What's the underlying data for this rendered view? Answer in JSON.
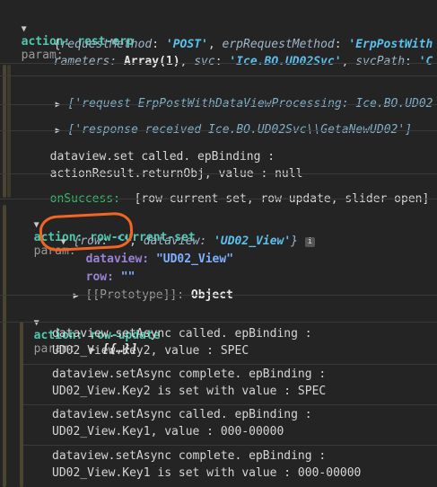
{
  "header": {
    "action_label": "action: rest-erp",
    "param_label": "param:",
    "obj_line1_prefix": "{",
    "k_requestMethod": "requestMethod",
    "v_requestMethod": "'POST'",
    "k_erpRequestMethod": "erpRequestMethod",
    "v_erpRequestMethod": "'ErpPostWith",
    "line2_pre": "rameters: ",
    "line2_arr": "Array(1)",
    "k_svc": "svc",
    "v_svc": "'Ice.BO.UD02Svc'",
    "k_svcPath": "svcPath",
    "v_svcPath": "'C"
  },
  "groups": {
    "request_line": "['request ErpPostWithDataViewProcessing: Ice.BO.UD02",
    "response_line": "['response received Ice.BO.UD02Svc\\\\GetaNewUD02']",
    "dataview_set_1": "dataview.set called. epBinding :",
    "dataview_set_2": "actionResult.returnObj, value : null",
    "onsuccess_label": "onSuccess:",
    "onsuccess_value": "[row-current-set, row-update, slider-open]"
  },
  "row_current_set": {
    "action_label": "action: row-current-set",
    "param_label": "param:",
    "preview_prefix": "{",
    "row_key": "row:",
    "row_val": "''",
    "dv_key": "dataview:",
    "dv_val": "'UD02_View'",
    "preview_suffix": "}",
    "info": "i",
    "prop_dataview_key": "dataview:",
    "prop_dataview_val": "\"UD02_View\"",
    "prop_row_key": "row:",
    "prop_row_val": "\"\"",
    "prototype_key": "[[Prototype]]:",
    "prototype_val": "Object"
  },
  "row_update": {
    "action_label": "action: row-update",
    "param_label": "param:",
    "param_value": "[{…}]",
    "messages": [
      [
        "dataview.setAsync called. epBinding :",
        "UD02_View.Key2, value : SPEC"
      ],
      [
        "dataview.setAsync complete. epBinding :",
        "UD02_View.Key2 is set with value : SPEC"
      ],
      [
        "dataview.setAsync called. epBinding :",
        "UD02_View.Key1, value : 000-00000"
      ],
      [
        "dataview.setAsync complete. epBinding :",
        "UD02_View.Key1 is set with value : 000-00000"
      ]
    ]
  },
  "colors": {
    "background": "#242424",
    "green": "#4ec9b0",
    "string": "#5bc0eb",
    "highlight_circle": "#f26522"
  }
}
